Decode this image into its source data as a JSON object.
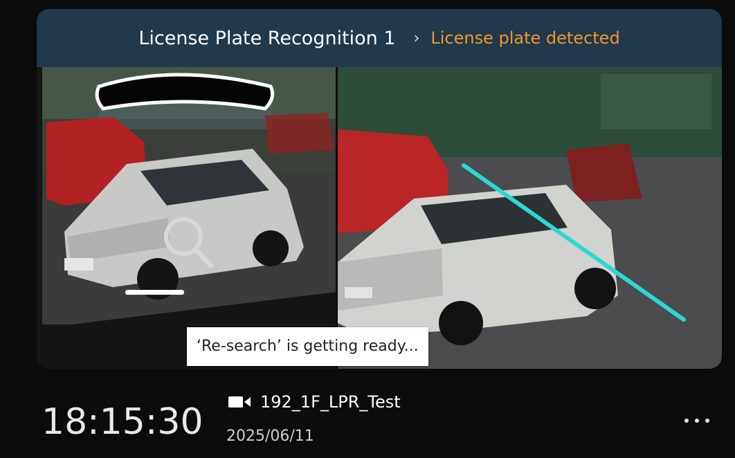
{
  "card": {
    "rule_name": "License Plate Recognition 1",
    "separator": "›",
    "event_status": "License plate detected",
    "colors": {
      "header_bg": "#22384b",
      "status": "#f0962b",
      "detection_line": "#2bd9d2"
    }
  },
  "snapshots": {
    "left_icons": [
      "search-icon"
    ],
    "tooltip": "‘Re-search’ is getting ready..."
  },
  "event": {
    "time": "18:15:30",
    "camera_icon": "video-camera-icon",
    "camera_name": "192_1F_LPR_Test",
    "date": "2025/06/11",
    "more_icon": "more-icon"
  }
}
